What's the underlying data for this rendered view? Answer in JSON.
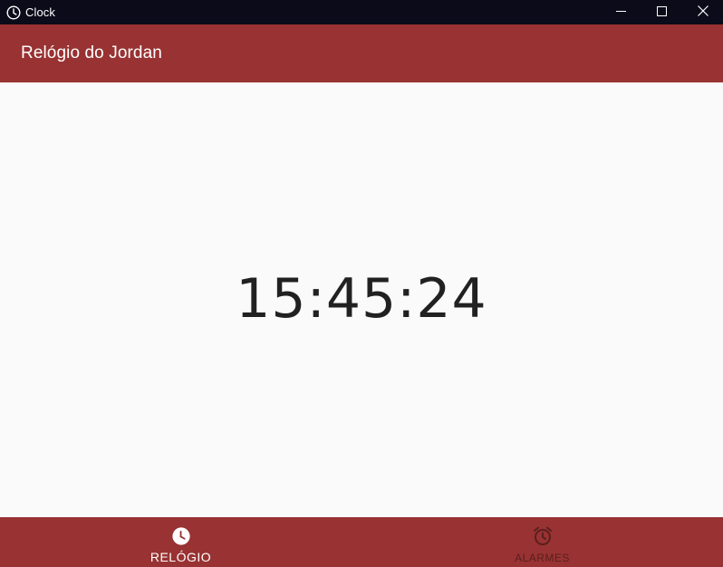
{
  "window": {
    "title": "Clock",
    "icon": "clock-icon",
    "controls": [
      "minimize-icon",
      "maximize-icon",
      "close-icon"
    ]
  },
  "appbar": {
    "title": "Relógio do Jordan"
  },
  "main": {
    "time": "15:45:24"
  },
  "bottom_nav": {
    "items": [
      {
        "label": "RELÓGIO",
        "icon": "clock-icon",
        "active": true
      },
      {
        "label": "ALARMES",
        "icon": "alarm-icon",
        "active": false
      }
    ]
  },
  "colors": {
    "titlebar": "#0b0b1a",
    "primary": "#993232",
    "background": "#fafafa",
    "text_dark": "#212121",
    "inactive_nav": "#5a1f1f"
  }
}
